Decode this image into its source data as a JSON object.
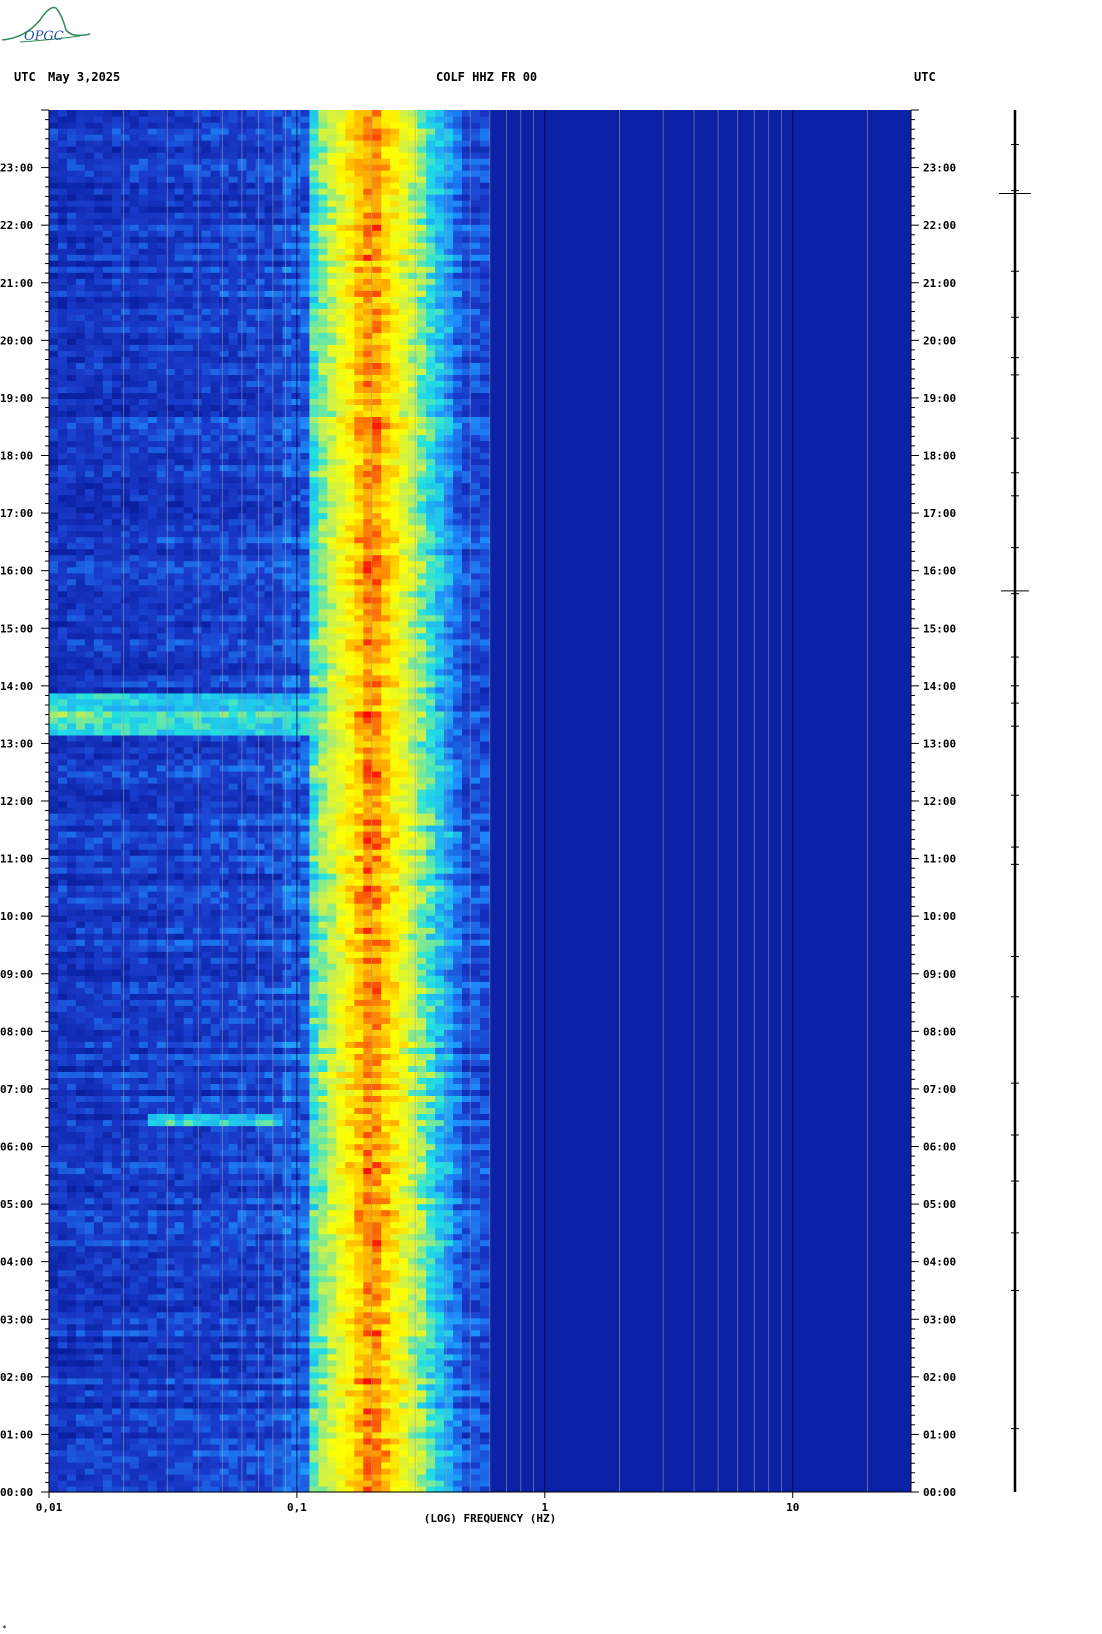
{
  "header": {
    "left_tz": "UTC",
    "date": "May 3,2025",
    "station": "COLF HHZ FR 00",
    "right_tz": "UTC"
  },
  "logo": {
    "text": "OPGC",
    "color": "#2e8b57"
  },
  "footer_mark": "*",
  "chart_data": {
    "type": "heatmap",
    "xlabel": "(LOG) FREQUENCY (HZ)",
    "x_scale": "log",
    "xlim": [
      0.01,
      30
    ],
    "x_ticks": [
      0.01,
      0.1,
      1,
      10
    ],
    "x_tick_labels": [
      "0,01",
      "0,1",
      "1",
      "10"
    ],
    "ylim_hours": [
      0,
      24
    ],
    "y_tick_labels": [
      "00:00",
      "01:00",
      "02:00",
      "03:00",
      "04:00",
      "05:00",
      "06:00",
      "07:00",
      "08:00",
      "09:00",
      "10:00",
      "11:00",
      "12:00",
      "13:00",
      "14:00",
      "15:00",
      "16:00",
      "17:00",
      "18:00",
      "19:00",
      "20:00",
      "21:00",
      "22:00",
      "23:00"
    ],
    "colormap": [
      "#0a1ea0",
      "#1a3ccc",
      "#1e90ff",
      "#21e1e1",
      "#c8f050",
      "#ffff00",
      "#ffa500",
      "#ff0000"
    ],
    "dominant_band_hz": [
      0.12,
      0.45
    ],
    "band_peak_hz": 0.2,
    "events": [
      {
        "start_hour": 13.15,
        "end_hour": 13.85,
        "fmin_hz": 0.01,
        "fmax_hz": 0.13,
        "level": 0.45
      },
      {
        "start_hour": 6.35,
        "end_hour": 6.55,
        "fmin_hz": 0.025,
        "fmax_hz": 0.09,
        "level": 0.4
      }
    ],
    "trace_marks_hours": [
      1.1,
      3.5,
      4.5,
      5.4,
      6.2,
      7.1,
      8.6,
      9.3,
      10.9,
      11.2,
      12.1,
      13.3,
      13.7,
      14.0,
      14.5,
      15.6,
      16.4,
      17.3,
      17.7,
      18.3,
      19.4,
      19.7,
      20.4,
      21.2,
      22.6,
      23.4
    ]
  }
}
